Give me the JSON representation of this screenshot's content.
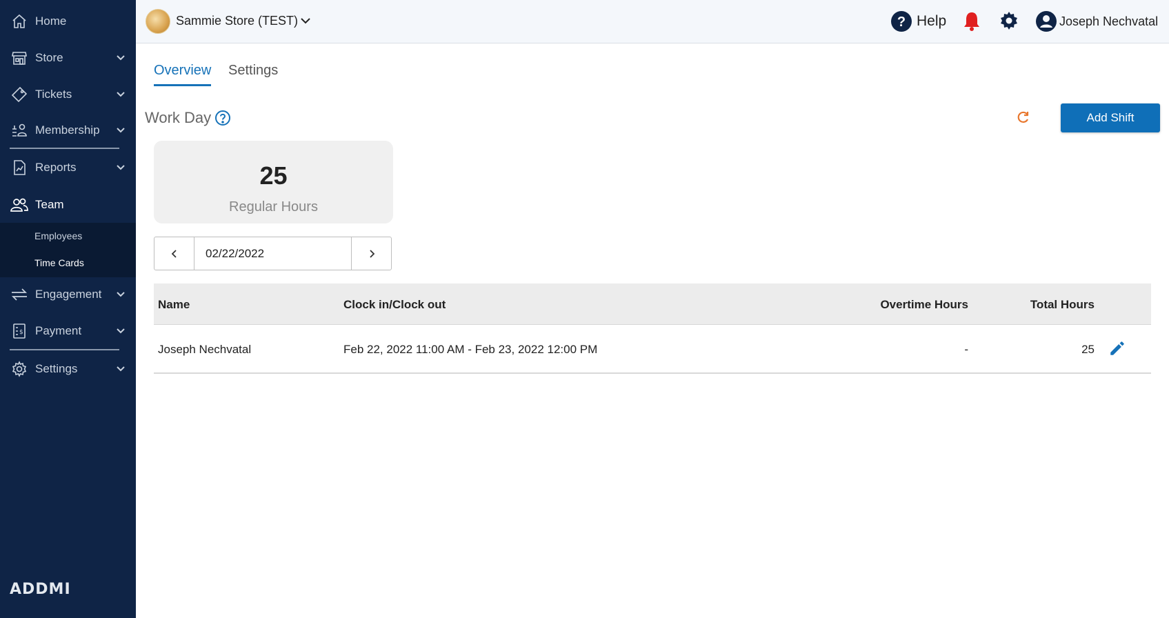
{
  "sidebar": {
    "items": [
      {
        "label": "Home",
        "icon": "home-icon"
      },
      {
        "label": "Store",
        "icon": "store-icon"
      },
      {
        "label": "Tickets",
        "icon": "ticket-icon"
      },
      {
        "label": "Membership",
        "icon": "membership-icon"
      },
      {
        "label": "Reports",
        "icon": "report-icon"
      },
      {
        "label": "Team",
        "icon": "team-icon"
      },
      {
        "label": "Engagement",
        "icon": "engagement-icon"
      },
      {
        "label": "Payment",
        "icon": "payment-icon"
      },
      {
        "label": "Settings",
        "icon": "settings-icon"
      }
    ],
    "team_sub": [
      {
        "label": "Employees"
      },
      {
        "label": "Time Cards"
      }
    ],
    "logo_text": "ADDMI"
  },
  "header": {
    "store_name": "Sammie Store (TEST)",
    "help_label": "Help",
    "user_name": "Joseph Nechvatal"
  },
  "tabs": [
    {
      "label": "Overview",
      "active": true
    },
    {
      "label": "Settings",
      "active": false
    }
  ],
  "workday": {
    "title": "Work Day",
    "add_button": "Add Shift",
    "stat_value": "25",
    "stat_label": "Regular Hours",
    "date": "02/22/2022"
  },
  "table": {
    "headers": [
      "Name",
      "Clock in/Clock out",
      "Overtime Hours",
      "Total Hours"
    ],
    "rows": [
      {
        "name": "Joseph Nechvatal",
        "clock": "Feb 22, 2022 11:00 AM - Feb 23, 2022 12:00 PM",
        "overtime": "-",
        "total": "25"
      }
    ]
  },
  "colors": {
    "sidebar_bg": "#0f2446",
    "accent": "#1672b8",
    "bell": "#e02020",
    "refresh": "#e8772e"
  }
}
